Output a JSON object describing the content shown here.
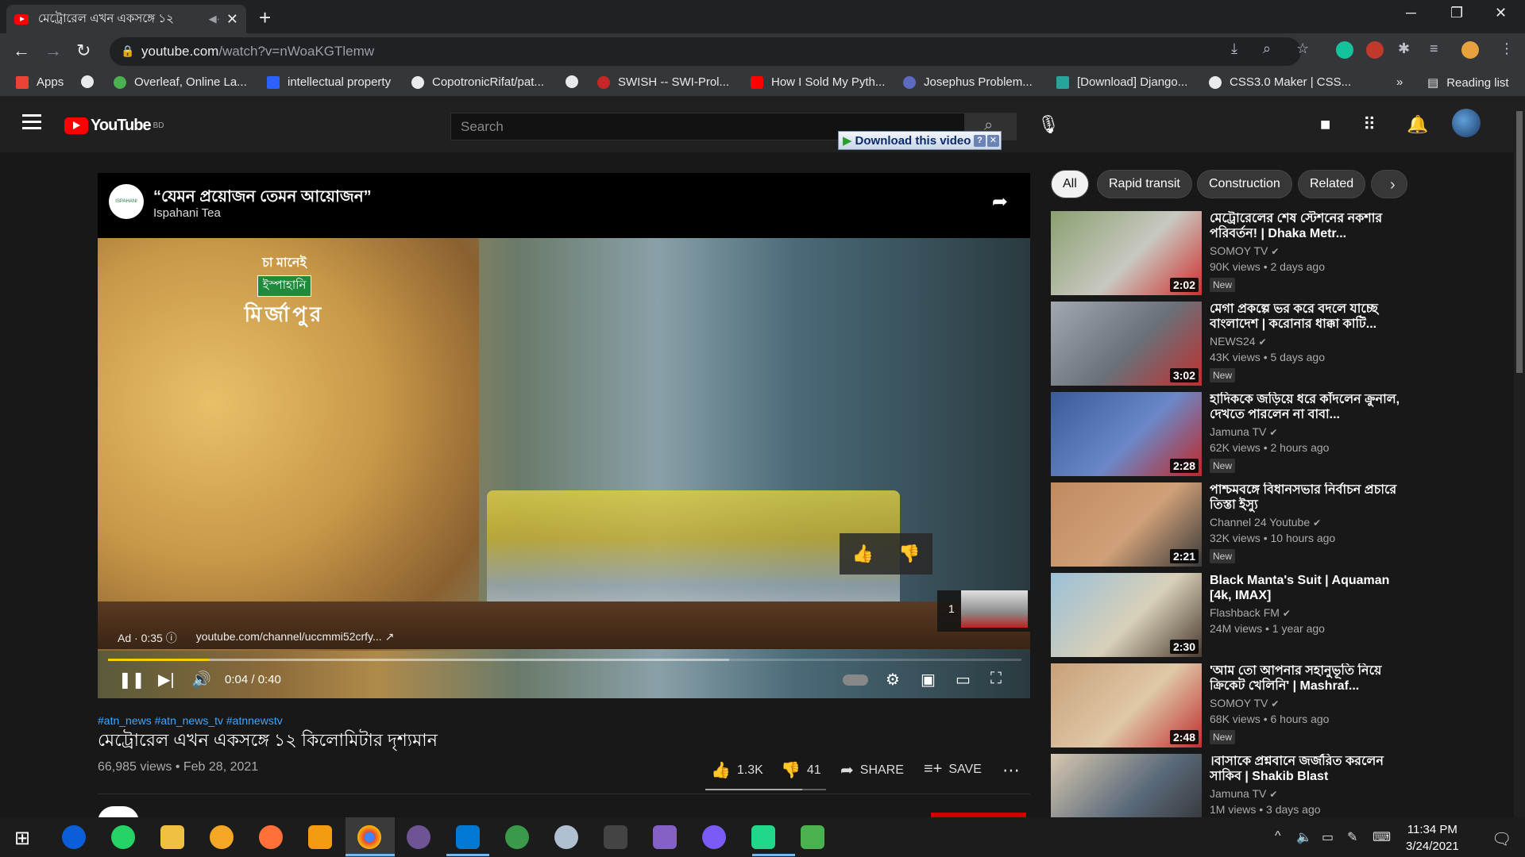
{
  "browser": {
    "tab_title": "মেট্রোরেল এখন একসঙ্গে ১২ ",
    "tab_mute": "◀·",
    "tab_close": "✕",
    "new_tab": "+",
    "url_host": "youtube.com",
    "url_path": "/watch?v=nWoaKGTlemw",
    "bookmarks": [
      {
        "label": "Apps",
        "color": "#ea4335"
      },
      {
        "label": "",
        "color": "#e8eaed"
      },
      {
        "label": "Overleaf, Online La...",
        "color": "#4caf50"
      },
      {
        "label": "intellectual property",
        "color": "#2962ff"
      },
      {
        "label": "CopotronicRifat/pat...",
        "color": "#e8eaed"
      },
      {
        "label": "",
        "color": "#e8eaed"
      },
      {
        "label": "SWISH -- SWI-Prol...",
        "color": "#c62828"
      },
      {
        "label": "How I Sold My Pyth...",
        "color": "#ff0000"
      },
      {
        "label": "Josephus Problem...",
        "color": "#5c6bc0"
      },
      {
        "label": "[Download] Django...",
        "color": "#26a69a"
      },
      {
        "label": "CSS3.0 Maker | CSS...",
        "color": "#e8eaed"
      }
    ],
    "bookmarks_more": "»",
    "reading_list": "Reading list"
  },
  "youtube": {
    "logo_text": "YouTube",
    "logo_region": "BD",
    "search_placeholder": "Search",
    "download_label": "Download this video",
    "download_help": "?",
    "download_close": "✕"
  },
  "ad": {
    "title": "“যেমন প্রয়োজন তেমন আয়োজন”",
    "channel": "Ispahani Tea",
    "logo_text": "ISPAHANI",
    "brand_line1": "চা মানেই",
    "brand_line2": "ইস্পাহানি",
    "brand_line3": "মির্জাপুর",
    "label": "Ad · 0:35",
    "info_icon": "ⓘ",
    "link": "youtube.com/channel/uccmmi52crfy...",
    "next_count": "1"
  },
  "player": {
    "time": "0:04 / 0:40",
    "progress_played_pct": 11,
    "progress_buffered_pct": 68
  },
  "video": {
    "hashtags": "#atn_news #atn_news_tv #atnnewstv",
    "title": "মেট্রোরেল এখন একসঙ্গে ১২ কিলোমিটার দৃশ্যমান",
    "views_date": "66,985 views • Feb 28, 2021",
    "likes": "1.3K",
    "dislikes": "41",
    "share": "SHARE",
    "save": "SAVE"
  },
  "chips": [
    "All",
    "Rapid transit",
    "Construction",
    "Related"
  ],
  "recommendations": [
    {
      "title": "মেট্রোরেলের শেষ স্টেশনের নকশার পরিবর্তন! | Dhaka Metr...",
      "channel": "SOMOY TV",
      "meta": "90K views • 2 days ago",
      "duration": "2:02",
      "badge": "New",
      "colors": [
        "#8aa070",
        "#c8c8c0",
        "#d03030"
      ]
    },
    {
      "title": "মেগা প্রকল্পে ভর করে বদলে যাচ্ছে বাংলাদেশ | করোনার ধাক্কা কাটি...",
      "channel": "NEWS24",
      "meta": "43K views • 5 days ago",
      "duration": "3:02",
      "badge": "New",
      "colors": [
        "#a0a8b0",
        "#6a7078",
        "#c03030"
      ]
    },
    {
      "title": "হাদিককে জড়িয়ে ধরে কাঁদলেন ক্রুনাল, দেখতে পারলেন না বাবা...",
      "channel": "Jamuna TV",
      "meta": "62K views • 2 hours ago",
      "duration": "2:28",
      "badge": "New",
      "colors": [
        "#3a5a9a",
        "#6a88c8",
        "#c02828"
      ]
    },
    {
      "title": "পাশ্চমবঙ্গে বিধানসভার নির্বাচন প্রচারে তিস্তা ইস্যু",
      "channel": "Channel 24 Youtube",
      "meta": "32K views • 10 hours ago",
      "duration": "2:21",
      "badge": "New",
      "colors": [
        "#c08a60",
        "#d0a078",
        "#3a3a3a"
      ]
    },
    {
      "title": "Black Manta's Suit | Aquaman [4k, IMAX]",
      "channel": "Flashback FM",
      "meta": "24M views • 1 year ago",
      "duration": "2:30",
      "badge": "",
      "colors": [
        "#9ac0d8",
        "#d8d0b8",
        "#4a3a30"
      ]
    },
    {
      "title": "'আম তো আপনার সহানুভূতি নিয়ে ক্রিকেট খেলিনি' | Mashraf...",
      "channel": "SOMOY TV",
      "meta": "68K views • 6 hours ago",
      "duration": "2:48",
      "badge": "New",
      "colors": [
        "#c8a078",
        "#e0c8a8",
        "#c03030"
      ]
    },
    {
      "title": "।বাসাকে প্রশ্নবানে জর্জরিত করলেন সাকিব | Shakib Blast",
      "channel": "Jamuna TV",
      "meta": "1M views • 3 days ago",
      "duration": "",
      "badge": "",
      "colors": [
        "#d8c8b0",
        "#5a6a7a",
        "#303030"
      ]
    }
  ],
  "taskbar": {
    "time": "11:34 PM",
    "date": "3/24/2021"
  },
  "colors": {
    "yt_red": "#ff0000",
    "progress_yellow": "#ffcc00",
    "link_blue": "#3ea6ff"
  }
}
